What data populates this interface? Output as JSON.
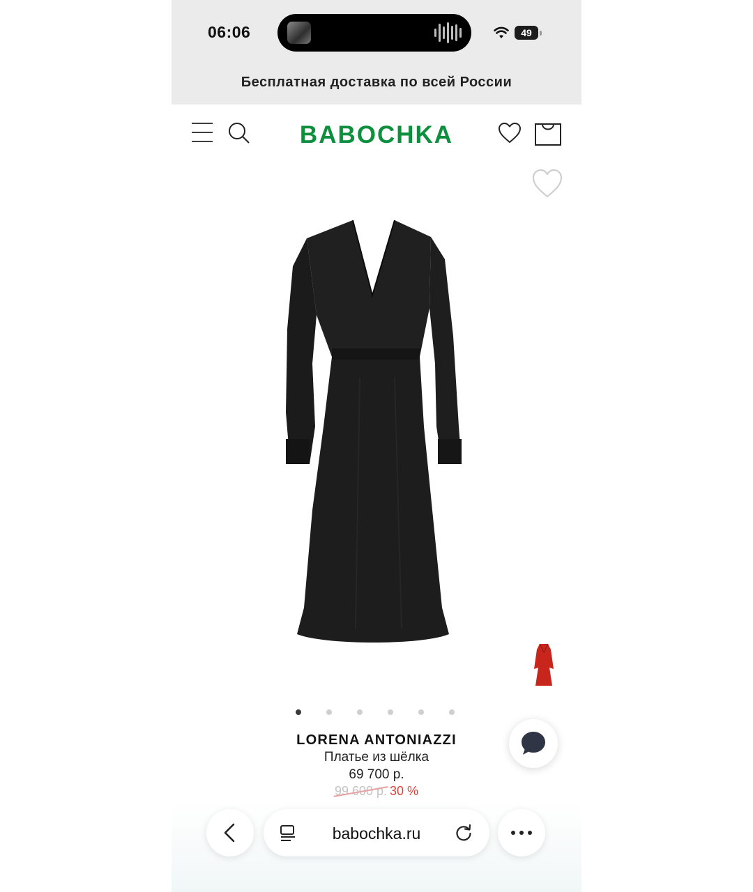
{
  "status_bar": {
    "time": "06:06",
    "battery": "49"
  },
  "promo_banner": "Бесплатная доставка по всей России",
  "header": {
    "logo": "BABOCHKA"
  },
  "gallery": {
    "slide_count": 6,
    "active_slide": 1
  },
  "product": {
    "brand": "LORENA ANTONIAZZI",
    "title": "Платье из шёлка",
    "price": "69 700 р.",
    "old_price": "99 600 р.",
    "discount": "30 %"
  },
  "browser": {
    "url": "babochka.ru"
  },
  "colors": {
    "brand_green": "#0d8f3d",
    "discount_red": "#e0403a",
    "dress": "#1b1b1b",
    "swatch_red": "#c8261c"
  }
}
